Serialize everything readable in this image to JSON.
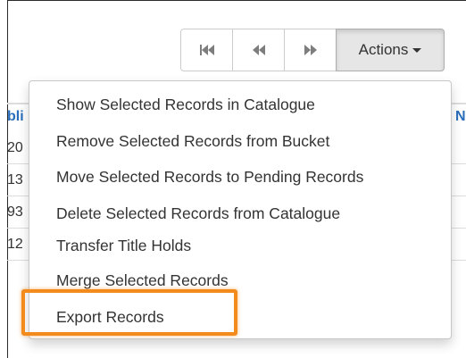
{
  "toolbar": {
    "actions_label": "Actions"
  },
  "icons": {
    "first": "first-page-icon",
    "prev": "previous-page-icon",
    "next": "next-page-icon"
  },
  "menu": {
    "items": [
      {
        "label": "Show Selected Records in Catalogue"
      },
      {
        "label": "Remove Selected Records from Bucket"
      },
      {
        "label": "Move Selected Records to Pending Records"
      },
      {
        "label": "Delete Selected Records from Catalogue"
      },
      {
        "label": "Transfer Title Holds"
      },
      {
        "label": "Merge Selected Records"
      },
      {
        "label": "Export Records"
      }
    ]
  },
  "table": {
    "header_left": "bli",
    "header_right": "N",
    "row_stubs": [
      "20",
      "13",
      "93",
      "12"
    ]
  },
  "colors": {
    "highlight": "#f28a1c",
    "link_blue": "#2a6ebb"
  }
}
